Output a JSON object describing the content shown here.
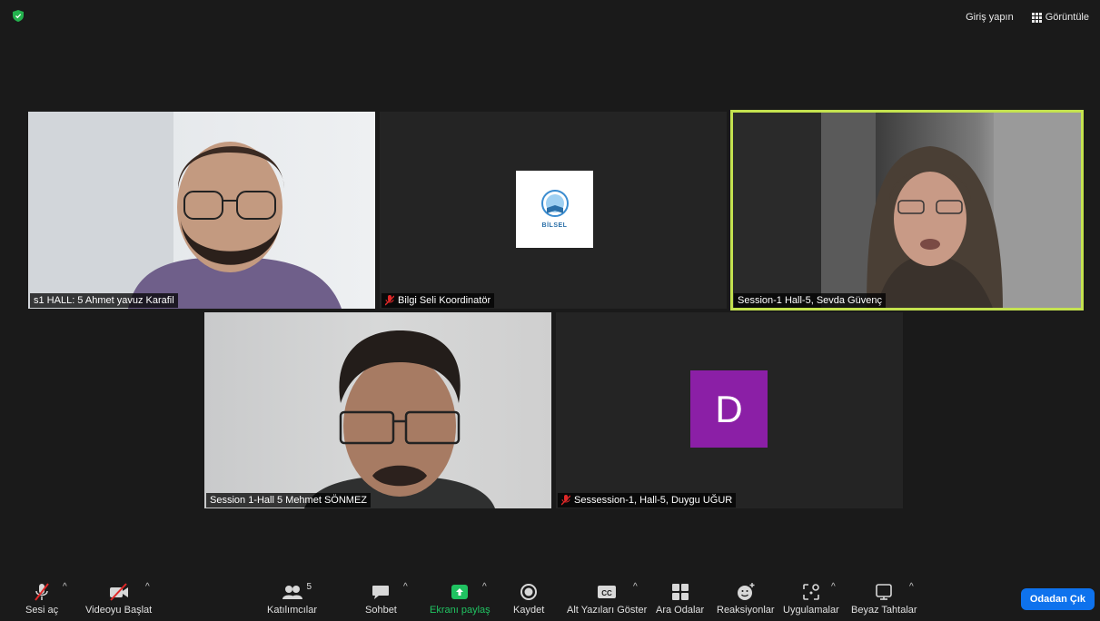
{
  "top_bar": {
    "signin_label": "Giriş yapın",
    "view_label": "Görüntüle"
  },
  "participants": [
    {
      "name": "s1 HALL: 5 Ahmet yavuz Karafil",
      "muted": false,
      "active": false
    },
    {
      "name": "Bilgi Seli Koordinatör",
      "muted": true,
      "active": false,
      "logo_text": "BİLSEL"
    },
    {
      "name": "Session-1  Hall-5, Sevda Güvenç",
      "muted": false,
      "active": true
    },
    {
      "name": "Session 1-Hall 5 Mehmet SÖNMEZ",
      "muted": false,
      "active": false
    },
    {
      "name": "Sessession-1, Hall-5, Duygu UĞUR",
      "muted": true,
      "active": false,
      "avatar_letter": "D"
    }
  ],
  "toolbar": {
    "unmute": "Sesi aç",
    "start_video": "Videoyu Başlat",
    "participants": "Katılımcılar",
    "participants_count": "5",
    "chat": "Sohbet",
    "share_screen": "Ekranı paylaş",
    "record": "Kaydet",
    "captions": "Alt Yazıları Göster",
    "captions_badge": "CC",
    "breakout": "Ara Odalar",
    "reactions": "Reaksiyonlar",
    "apps": "Uygulamalar",
    "whiteboard": "Beyaz Tahtalar",
    "leave": "Odadan Çık"
  },
  "colors": {
    "active_speaker": "#c4e24f",
    "share_green": "#20c261",
    "leave_blue": "#0e72ed",
    "avatar_purple": "#8b1fa6"
  }
}
